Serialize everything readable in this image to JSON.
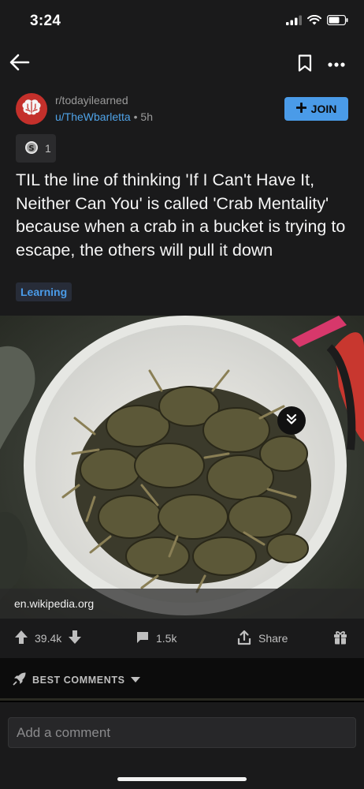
{
  "status_bar": {
    "time": "3:24"
  },
  "post": {
    "subreddit": "r/todayilearned",
    "author": "u/TheWbarletta",
    "separator": " • ",
    "age": "5h",
    "join_label": "JOIN",
    "award_count": "1",
    "title": "TIL the line of thinking 'If I Can't Have It, Neither Can You' is called 'Crab Mentality' because when a crab in a bucket is trying to escape, the others will pull it down",
    "flair": "Learning",
    "link_domain": "en.wikipedia.org"
  },
  "actions": {
    "score": "39.4k",
    "comments": "1.5k",
    "share_label": "Share"
  },
  "comments": {
    "sort_label": "BEST COMMENTS",
    "input_placeholder": "Add a comment"
  },
  "colors": {
    "accent": "#4a9be8",
    "background": "#1a1a1b",
    "avatar": "#c4302b"
  }
}
